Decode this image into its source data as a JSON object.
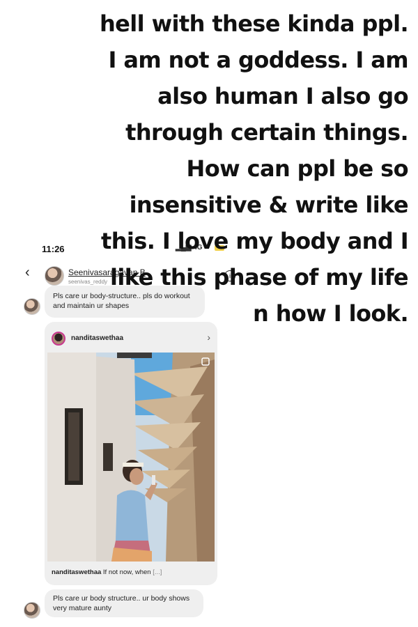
{
  "caption": {
    "lines": [
      "hell with these kinda ppl.",
      "I am not a goddess. I am",
      "also human I also go",
      "through certain things.",
      "How can ppl be so",
      "insensitive & write like",
      "this. I love my body and I",
      "like this phase of my life",
      "n how I look."
    ]
  },
  "status_bar": {
    "time": "11:26",
    "signal": "4G"
  },
  "chat_header": {
    "name": "Seenivasaragavan B",
    "handle": "seenivas_reddy",
    "back_icon": "chevron-left-icon",
    "info_icon": "info-icon"
  },
  "messages": {
    "first": "Pls care ur body-structure.. pls do workout and maintain ur shapes",
    "last": "Pls care ur body structure.. ur body shows very mature aunty"
  },
  "shared_post": {
    "username": "nanditaswethaa",
    "caption_user": "nanditaswethaa",
    "caption_text": "If not now, when",
    "caption_more": "[...]"
  },
  "colors": {
    "bubble": "#efefef",
    "text": "#111111",
    "story_ring": "#c8388f",
    "battery": "#f1d04b"
  }
}
